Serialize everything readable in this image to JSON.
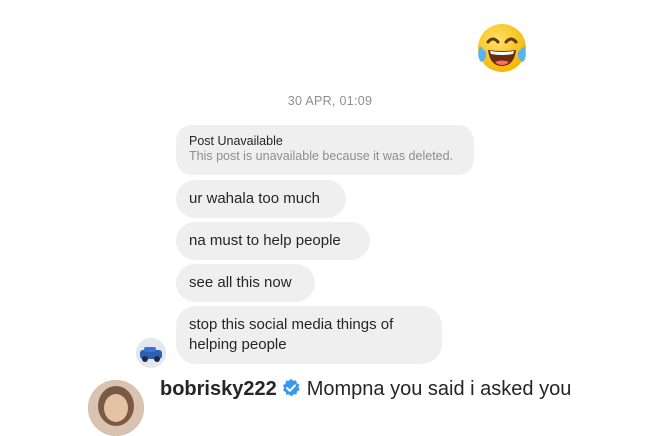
{
  "thread": {
    "timestamp": "30 APR, 01:09",
    "post_card": {
      "title": "Post Unavailable",
      "subtitle": "This post is unavailable because it was deleted."
    },
    "messages": [
      "ur wahala too much",
      "na must to help people",
      "see all this now",
      "stop this social media things of helping people"
    ]
  },
  "comment": {
    "username": "bobrisky222",
    "text": "Mompna you said i asked you"
  },
  "icons": {
    "sent_emoji": "face-with-tears-of-joy",
    "verified": "verified-badge-icon"
  },
  "colors": {
    "bubble_bg": "#efefef",
    "timestamp": "#8e8e8e",
    "verified_blue": "#3897f0",
    "emoji_yellow": "#ffcc33"
  }
}
